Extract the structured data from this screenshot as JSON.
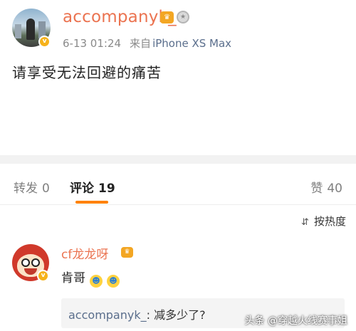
{
  "post": {
    "username": "accompanyk_",
    "date": "6-13 01:24",
    "source_prefix": "来自",
    "device": "iPhone XS Max",
    "text": "请享受无法回避的痛苦",
    "verified_badge": "v",
    "level_icon": "level-icon",
    "medal_icon": "medal-icon"
  },
  "tabs": {
    "repost_label": "转发",
    "repost_count": "0",
    "comment_label": "评论",
    "comment_count": "19",
    "like_label": "赞",
    "like_count": "40",
    "active": "comment",
    "accent_color": "#ff8200"
  },
  "sort": {
    "label": "按热度",
    "icon": "sort-icon"
  },
  "comment": {
    "username": "cf龙龙呀",
    "text": "肯哥",
    "emojis": [
      "emoji-icon",
      "emoji-icon"
    ],
    "reply": {
      "user": "accompanyk_",
      "separator": ":",
      "text": "减多少了?"
    }
  },
  "watermark": "头条 @穿越火线赛事姐",
  "colors": {
    "username": "#eb7350",
    "meta": "#8a8a8a",
    "link": "#5a6e8c"
  }
}
